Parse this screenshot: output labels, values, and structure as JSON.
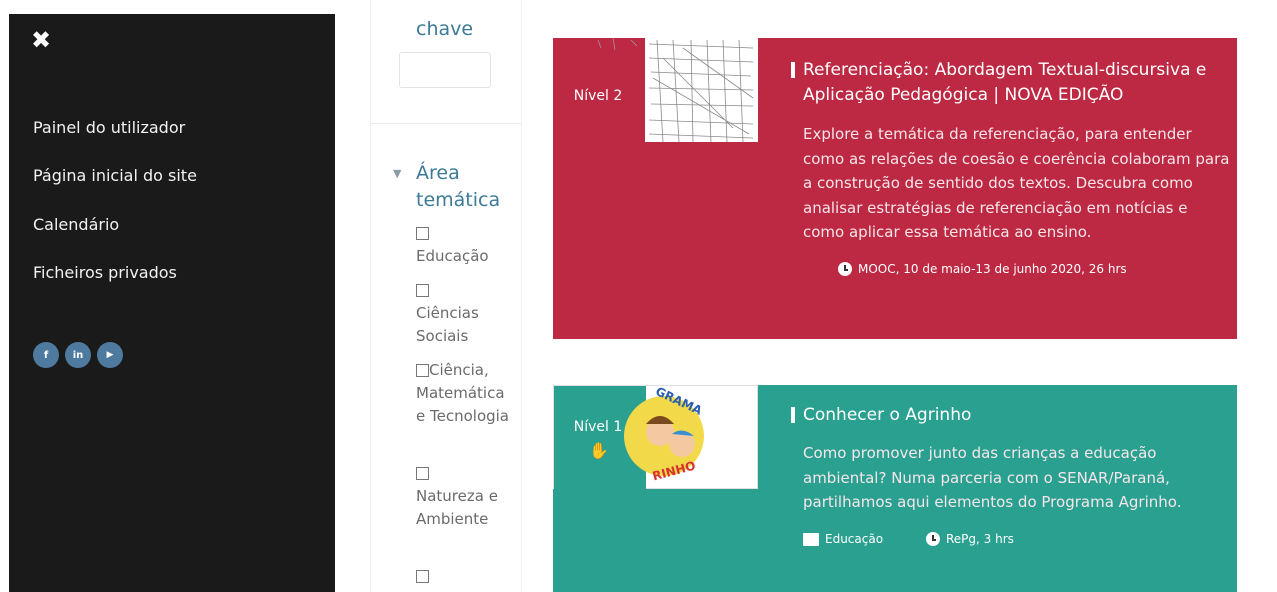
{
  "sidebar": {
    "close_glyph": "✖",
    "items": [
      {
        "label": "Painel do utilizador"
      },
      {
        "label": "Página inicial do site"
      },
      {
        "label": "Calendário"
      },
      {
        "label": "Ficheiros privados"
      }
    ],
    "social": [
      {
        "icon": "facebook-icon",
        "glyph": "f"
      },
      {
        "icon": "linkedin-icon",
        "glyph": "in"
      },
      {
        "icon": "youtube-icon",
        "glyph": "▶"
      }
    ]
  },
  "filter": {
    "keyword_label": "chave",
    "keyword_value": "",
    "area_caret": "▼",
    "area_label": "Área temática",
    "options": [
      {
        "label": "Educação"
      },
      {
        "label": "Ciências Sociais"
      },
      {
        "label": "Ciência, Matemática e Tecnologia"
      },
      {
        "label": "Natureza e Ambiente"
      }
    ]
  },
  "courses": [
    {
      "level": "Nível 2",
      "title": "Referenciação: Abordagem Textual-discursiva e Aplicação Pedagógica | NOVA EDIÇÃO",
      "description": "Explore a temática da referenciação, para entender como as relações de coesão e coerência colaboram para a construção de sentido dos textos. Descubra como analisar estratégias de referenciação em notícias e como aplicar essa temática ao ensino.",
      "meta": "MOOC, 10 de maio-13 de junho 2020, 26 hrs",
      "color": "#bd2843"
    },
    {
      "level": "Nível 1",
      "thumb_text_top": "GRAMA",
      "thumb_text_bottom": "RINHO",
      "title": "Conhecer o Agrinho",
      "description": "Como promover junto das crianças a educação ambiental? Numa parceria com o SENAR/Paraná, partilhamos aqui elementos do Programa Agrinho.",
      "category": "Educação",
      "meta": "RePg, 3 hrs",
      "color": "#2aa090"
    }
  ],
  "colors": {
    "sidebar_bg": "#1a1a1a",
    "accent_blue": "#3d7a97",
    "social_blue": "#4f7aa0"
  }
}
